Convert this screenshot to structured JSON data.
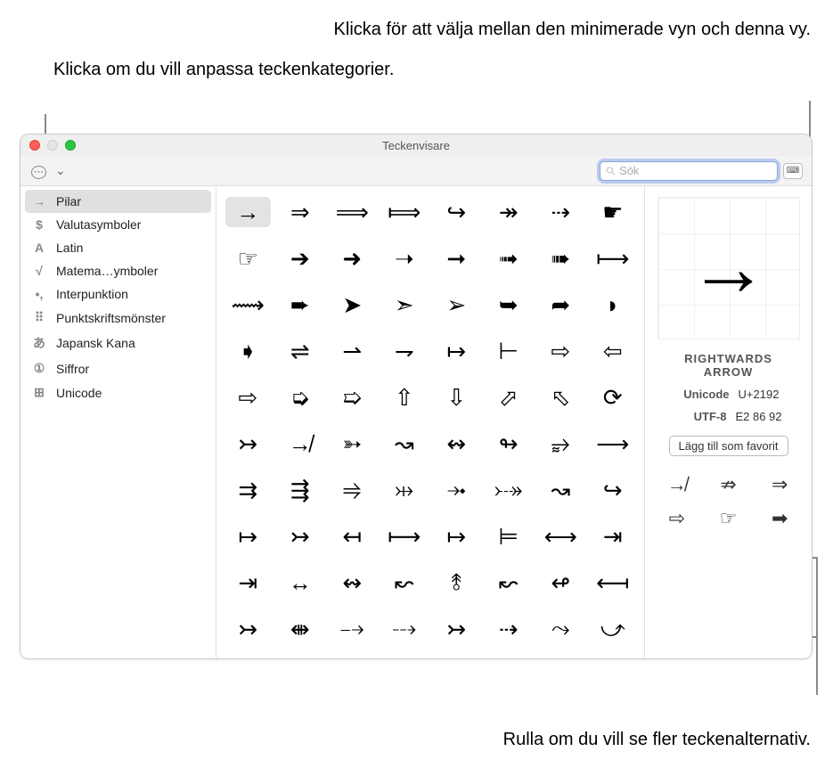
{
  "callouts": {
    "top_left": "Klicka om du vill anpassa teckenkategorier.",
    "top_right": "Klicka för att välja mellan den minimerade vyn och denna vy.",
    "bottom_right": "Rulla om du vill se fler teckenalternativ."
  },
  "window": {
    "title": "Teckenvisare"
  },
  "toolbar": {
    "settings_icon": "⋯",
    "dropdown_icon": "⌄",
    "search_placeholder": "Sök",
    "toggle_view_icon": "⌨"
  },
  "sidebar": {
    "items": [
      {
        "icon": "→",
        "label": "Pilar",
        "selected": true
      },
      {
        "icon": "$",
        "label": "Valutasymboler",
        "selected": false
      },
      {
        "icon": "A",
        "label": "Latin",
        "selected": false
      },
      {
        "icon": "√",
        "label": "Matema…ymboler",
        "selected": false
      },
      {
        "icon": "•,",
        "label": "Interpunktion",
        "selected": false
      },
      {
        "icon": "⠿",
        "label": "Punktskriftsmönster",
        "selected": false
      },
      {
        "icon": "あ",
        "label": "Japansk Kana",
        "selected": false
      },
      {
        "icon": "①",
        "label": "Siffror",
        "selected": false
      },
      {
        "icon": "⊞",
        "label": "Unicode",
        "selected": false
      }
    ]
  },
  "grid": {
    "selected_index": 0,
    "glyphs": [
      "→",
      "⇒",
      "⟹",
      "⟾",
      "↪",
      "↠",
      "⇢",
      "☛",
      "☞",
      "➔",
      "➜",
      "➝",
      "➞",
      "➟",
      "➠",
      "⟼",
      "⟿",
      "➨",
      "➤",
      "➣",
      "➢",
      "➥",
      "➦",
      "◗",
      "➧",
      "⇌",
      "⇀",
      "⇁",
      "↦",
      "⊢",
      "⇨",
      "⇦",
      "⇨",
      "➭",
      "➯",
      "⇧",
      "⇩",
      "⬀",
      "⬁",
      "⟳",
      "↣",
      "↛",
      "➳",
      "↝",
      "↭",
      "↬",
      "⥵",
      "⟶",
      "⇉",
      "⇶",
      "⥤",
      "⤔",
      "⤞",
      "⤐",
      "↝",
      "↪",
      "↦",
      "↣",
      "↤",
      "⟼",
      "↦",
      "⊨",
      "⟷",
      "⇥",
      "⇥",
      "↔",
      "↭",
      "↜",
      "⥉",
      "↜",
      "↫",
      "⟻",
      "↣",
      "⇼",
      "⤍",
      "⤏",
      "↣",
      "⇢",
      "⤳",
      "⤻"
    ]
  },
  "detail": {
    "glyph": "→",
    "name_l1": "RIGHTWARDS",
    "name_l2": "ARROW",
    "unicode_label": "Unicode",
    "unicode_value": "U+2192",
    "utf8_label": "UTF-8",
    "utf8_value": "E2 86 92",
    "favorite_button": "Lägg till som favorit",
    "variants": [
      "↛",
      "⇏",
      "⇒",
      "⇨",
      "☞",
      "➡"
    ]
  }
}
